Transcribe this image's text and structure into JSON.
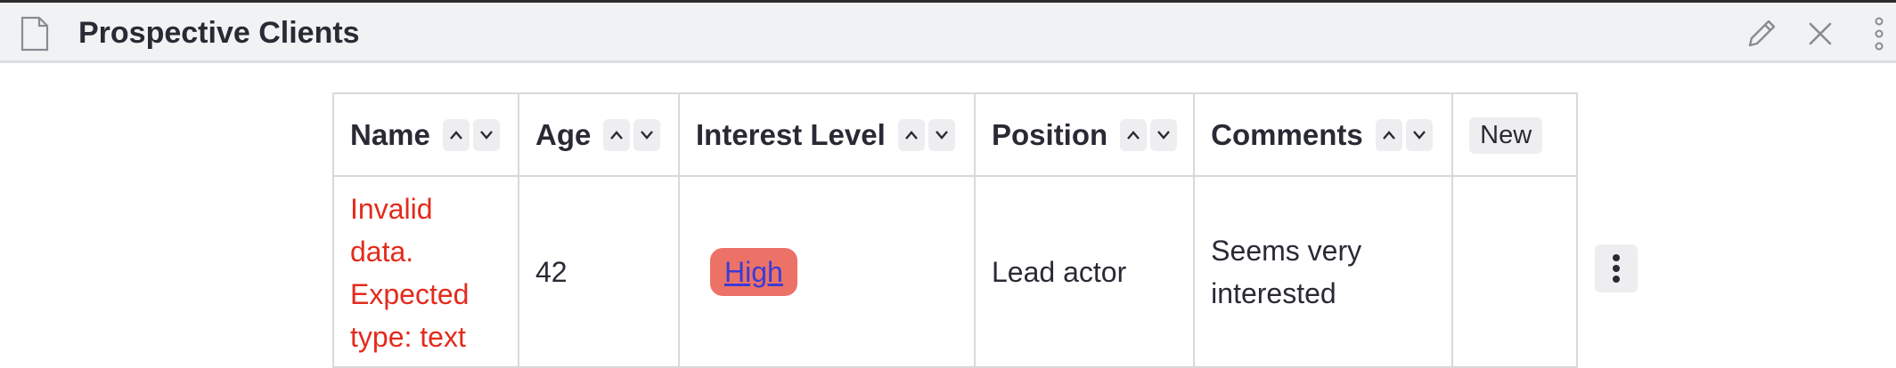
{
  "window": {
    "title": "Prospective Clients",
    "icons": [
      "document-icon",
      "pencil-icon",
      "close-icon",
      "kebab-menu-icon"
    ]
  },
  "table": {
    "columns": [
      {
        "label": "Name",
        "sortable": true
      },
      {
        "label": "Age",
        "sortable": true
      },
      {
        "label": "Interest Level",
        "sortable": true
      },
      {
        "label": "Position",
        "sortable": true
      },
      {
        "label": "Comments",
        "sortable": true
      }
    ],
    "new_button_label": "New",
    "rows": [
      {
        "name": "Invalid data. Expected type: text",
        "age": "42",
        "interest_level": "High",
        "position": "Lead actor",
        "comments": "Seems very interested"
      }
    ]
  },
  "colors": {
    "error_text": "#e32b1c",
    "pill_bg": "#ec7267",
    "link": "#3b3bd6"
  }
}
